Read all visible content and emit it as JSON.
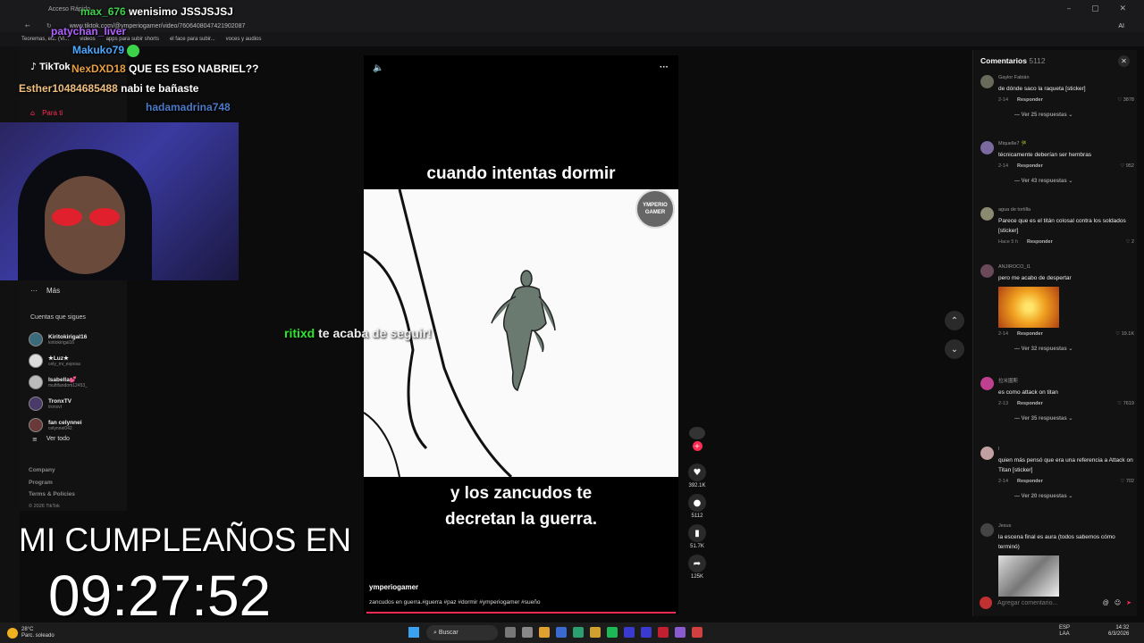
{
  "browser": {
    "tab_label": "Acceso Rápido",
    "url": "www.tiktok.com/@ymperiogamer/video/7606408047421902087",
    "bookmarks": [
      "Teoremas, etc. (Vi...",
      "videos",
      "apps para subir shorts",
      "el face para subir...",
      "voces y audios"
    ]
  },
  "chat": [
    {
      "user": "max_676",
      "message": "wenisimo JSSJSJSJ",
      "user_color": "#3cd34a"
    },
    {
      "user": "patychan_liver",
      "message": "",
      "user_color": "#b060ff"
    },
    {
      "user": "Makuko79",
      "message": "",
      "user_color": "#4aa8ff"
    },
    {
      "user": "NexDXD18",
      "message": "QUE ES ESO NABRIEL??",
      "user_color": "#e8a040"
    },
    {
      "user": "Esther10484685488",
      "message": "nabi te bañaste",
      "user_color": "#f0c080"
    },
    {
      "user": "hadamadrina748",
      "message": "",
      "user_color": "#4a7ac8"
    }
  ],
  "tiktok": {
    "logo": "TikTok",
    "para_ti": "Para ti",
    "mas": "Más",
    "following_header": "Cuentas que sigues",
    "following": [
      {
        "name": "Kiritokirigal16",
        "handle": "kiritokirigal16"
      },
      {
        "name": "★Luz★",
        "handle": "cely_mi_esposa"
      },
      {
        "name": "Isabella💕",
        "handle": "multifandom12453_"
      },
      {
        "name": "TronxTV",
        "handle": "tronxvt"
      },
      {
        "name": "fan celynnei",
        "handle": "celynnei042"
      }
    ],
    "ver_todo": "Ver todo",
    "footer": [
      "Company",
      "Program",
      "Terms & Policies",
      "© 2026 TikTok"
    ]
  },
  "video": {
    "caption_top": "cuando intentas dormir",
    "caption_bottom_1": "y los zancudos te",
    "caption_bottom_2": "decretan la guerra.",
    "watermark": "YMPERIO GAMER",
    "author": "ymperiogamer",
    "description": "zancudos en guerra.#guerra #paz #dormir #ymperiogamer #sueño",
    "progress": 0.98
  },
  "toast": {
    "user": "ritixd",
    "message": "te acaba de seguir!"
  },
  "actions": {
    "likes": "392.1K",
    "comments": "5112",
    "saves": "51.7K",
    "shares": "125K"
  },
  "comments_panel": {
    "title": "Comentarios",
    "count": "5112",
    "input_placeholder": "Agregar comentario...",
    "items": [
      {
        "user": "Gaylor Fabián",
        "text": "de dónde saco la raqueta [sticker]",
        "date": "2-14",
        "reply": "Responder",
        "likes": "3878",
        "replies": "Ver 25 respuestas"
      },
      {
        "user": "Miquelle7 🎋",
        "text": "técnicamente deberían ser hembras",
        "date": "2-14",
        "reply": "Responder",
        "likes": "952",
        "replies": "Ver 43 respuestas"
      },
      {
        "user": "agua de tortilla",
        "text": "Parece que es el titán colosal contra los soldados [sticker]",
        "date": "Hace 5 h",
        "reply": "Responder",
        "likes": "2",
        "replies": ""
      },
      {
        "user": "ANJIROCO_I1",
        "text": "pero me acabo de despertar",
        "date": "2-14",
        "reply": "Responder",
        "likes": "19.1K",
        "replies": "Ver 32 respuestas",
        "image": "fire"
      },
      {
        "user": "拉米園斯",
        "text": "es como attack on titan",
        "date": "2-13",
        "reply": "Responder",
        "likes": "7619",
        "replies": "Ver 35 respuestas"
      },
      {
        "user": "l",
        "text": "quien más pensó que era una referencia a Attack on Titan [sticker]",
        "date": "2-14",
        "reply": "Responder",
        "likes": "702",
        "replies": "Ver 20 respuestas"
      },
      {
        "user": "Jesus",
        "text": "la escena final es aura (todos sabemos cómo terminó)",
        "date": "",
        "reply": "",
        "likes": "",
        "replies": "",
        "image": "gray"
      }
    ]
  },
  "countdown": {
    "label": "MI CUMPLEAÑOS EN",
    "time": "09:27:52"
  },
  "taskbar": {
    "weather_temp": "28°C",
    "weather_desc": "Parc. soleado",
    "search": "Buscar",
    "lang": "ESP",
    "lang2": "LAA",
    "time": "14:32",
    "date": "6/3/2026"
  }
}
